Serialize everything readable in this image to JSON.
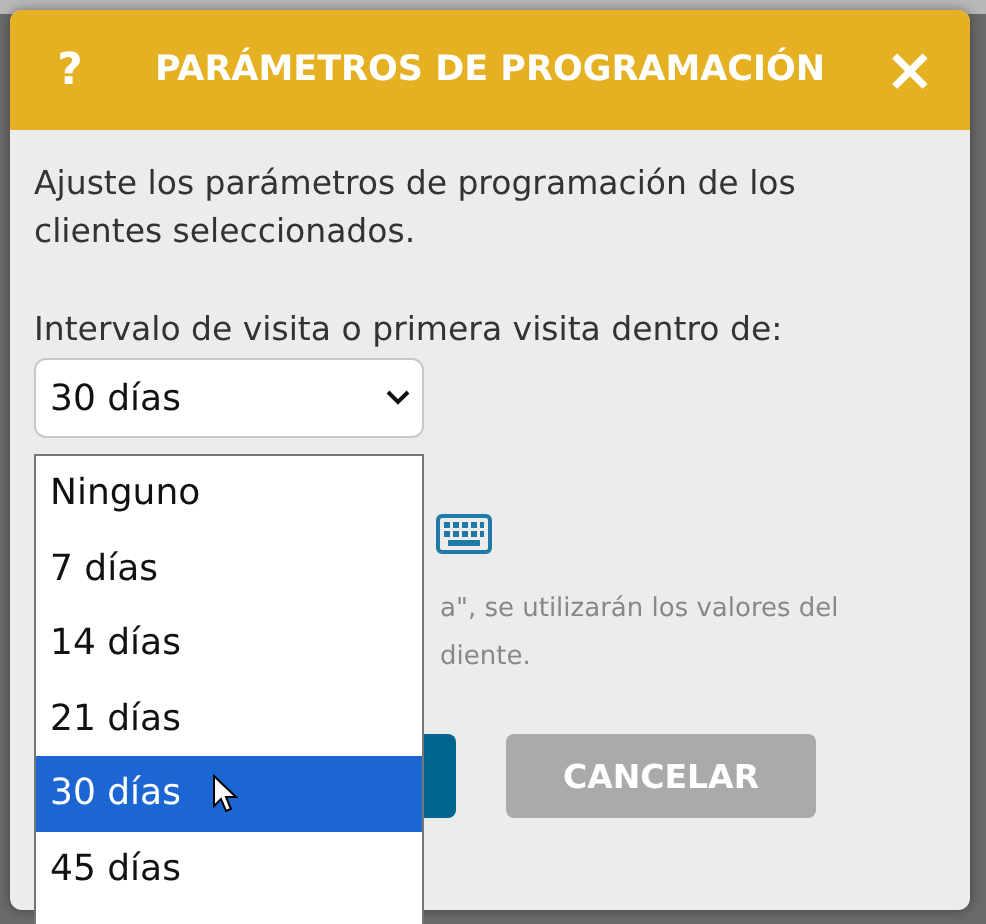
{
  "dialog": {
    "help": "?",
    "title": "PARÁMETROS DE PROGRAMACIÓN",
    "close": "×",
    "description": "Ajuste los parámetros de programación de los clientes seleccionados.",
    "interval_label": "Intervalo de visita o primera visita dentro de:",
    "interval_select": {
      "value": "30 días",
      "expanded": true
    },
    "note_lines": [
      "a\", se utilizarán los valores del",
      "diente."
    ],
    "buttons": [
      {
        "kind": "primary"
      },
      {
        "kind": "secondary",
        "label": "CANCELAR"
      }
    ]
  },
  "dropdown": {
    "options": [
      {
        "label": "Ninguno",
        "selected": false
      },
      {
        "label": "7 días",
        "selected": false
      },
      {
        "label": "14 días",
        "selected": false
      },
      {
        "label": "21 días",
        "selected": false
      },
      {
        "label": "30 días",
        "selected": true
      },
      {
        "label": "45 días",
        "selected": false
      }
    ]
  }
}
